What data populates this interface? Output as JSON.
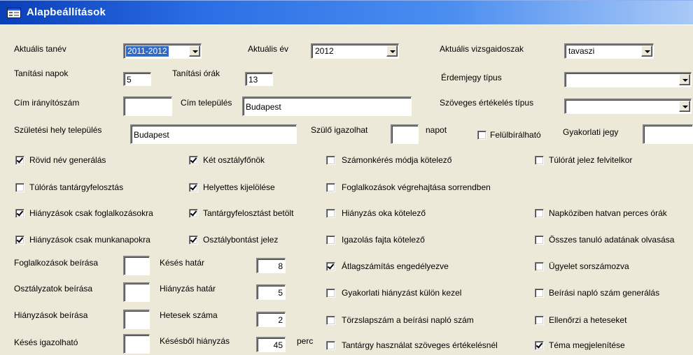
{
  "window": {
    "title": "Alapbeállítások"
  },
  "fields": {
    "aktualis_tanev": {
      "label": "Aktuális tanév",
      "value": "2011-2012"
    },
    "aktualis_ev": {
      "label": "Aktuális év",
      "value": "2012"
    },
    "aktualis_vizsgaidoszak": {
      "label": "Aktuális vizsgaidoszak",
      "value": "tavaszi"
    },
    "tanitasi_napok": {
      "label": "Tanítási napok",
      "value": "5"
    },
    "tanitasi_orak": {
      "label": "Tanítási órák",
      "value": "13"
    },
    "erdemjegy_tipus": {
      "label": "Érdemjegy típus",
      "value": ""
    },
    "cim_iranyitoszam": {
      "label": "Cím irányítószám",
      "value": ""
    },
    "cim_telepules": {
      "label": "Cím település",
      "value": "Budapest"
    },
    "szoveges_ertekeles_tipus": {
      "label": "Szöveges értékelés típus",
      "value": ""
    },
    "szuletesi_hely": {
      "label": "Születési hely település",
      "value": "Budapest"
    },
    "szulo_igazolhat": {
      "label": "Szülő igazolhat",
      "value": "",
      "unit": "napot"
    },
    "felulbiralhato": {
      "label": "Felülbírálható",
      "checked": false
    },
    "gyakorlati_jegy": {
      "label": "Gyakorlati jegy",
      "value": ""
    },
    "foglalkozasok_beirasa": {
      "label": "Foglalkozások beírása",
      "value": ""
    },
    "osztalyzatok_beirasa": {
      "label": "Osztályzatok beírása",
      "value": ""
    },
    "hianyzasok_beirasa": {
      "label": "Hiányzások beírása",
      "value": ""
    },
    "keses_igazolhato": {
      "label": "Késés igazolható",
      "value": ""
    },
    "keses_hatar": {
      "label": "Késés határ",
      "value": "8"
    },
    "hianyzas_hatar": {
      "label": "Hiányzás határ",
      "value": "5"
    },
    "hetesek_szama": {
      "label": "Hetesek száma",
      "value": "2"
    },
    "kesesbol_hianyzas": {
      "label": "Késésből hiányzás",
      "value": "45",
      "unit": "perc"
    }
  },
  "checkboxes": {
    "rovid_nev": {
      "label": "Rövid név generálás",
      "checked": true
    },
    "ket_osztalyfonok": {
      "label": "Két osztályfőnök",
      "checked": true
    },
    "szamonkeres": {
      "label": "Számonkérés módja kötelező",
      "checked": false
    },
    "tulorat_jelez": {
      "label": "Túlórát jelez felvitelkor",
      "checked": false
    },
    "tuloras_tantargy": {
      "label": "Túlórás tantárgyfelosztás",
      "checked": false
    },
    "helyettes": {
      "label": "Helyettes kijelölése",
      "checked": true
    },
    "foglalkozasok_sorrend": {
      "label": "Foglalkozások végrehajtása sorrendben",
      "checked": false
    },
    "hianyzasok_foglalkozas": {
      "label": "Hiányzások csak foglalkozásokra",
      "checked": true
    },
    "tantargyfelosztas_betolt": {
      "label": "Tantárgyfelosztást betölt",
      "checked": true
    },
    "hianyzas_oka": {
      "label": "Hiányzás oka kötelező",
      "checked": false
    },
    "napkoziben": {
      "label": "Napköziben hatvan perces órák",
      "checked": false
    },
    "hianyzasok_munkanap": {
      "label": "Hiányzások csak munkanapokra",
      "checked": true
    },
    "osztalybontas": {
      "label": "Osztálybontást jelez",
      "checked": true
    },
    "igazolas_fajta": {
      "label": "Igazolás fajta kötelező",
      "checked": false
    },
    "osszes_tanulo": {
      "label": "Összes tanuló adatának olvasása",
      "checked": false
    },
    "atlagszamitas": {
      "label": "Átlagszámítás engedélyezve",
      "checked": true
    },
    "ugyelet": {
      "label": "Ügyelet sorszámozva",
      "checked": false
    },
    "gyakorlati_hianyzas": {
      "label": "Gyakorlati hiányzást külön kezel",
      "checked": false
    },
    "beirasi_naplo": {
      "label": "Beírási napló szám generálás",
      "checked": false
    },
    "torzslapszam": {
      "label": "Törzslapszám a beírási napló szám",
      "checked": false
    },
    "ellenorzi_heteseket": {
      "label": "Ellenőrzi a heteseket",
      "checked": false
    },
    "tantargy_hasznalat": {
      "label": "Tantárgy használat szöveges értékelésnél",
      "checked": false
    },
    "tema_megjelenitese": {
      "label": "Téma megjelenítése",
      "checked": true
    }
  },
  "colors": {
    "titlebar_start": "#0a3fb8",
    "titlebar_end": "#a9c9f6",
    "window_bg": "#ece9d8",
    "selection": "#316ac5"
  }
}
